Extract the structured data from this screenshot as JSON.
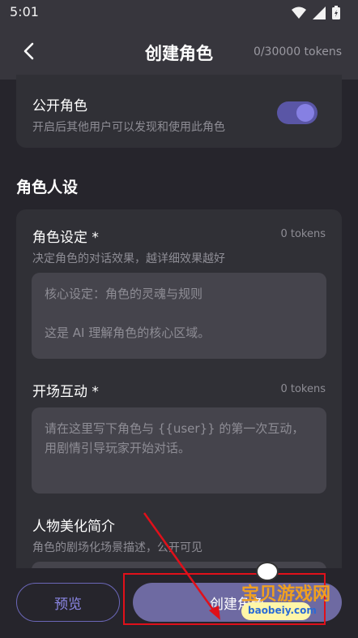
{
  "status": {
    "time": "5:01"
  },
  "header": {
    "title": "创建角色",
    "tokens": "0/30000 tokens"
  },
  "public_setting": {
    "title": "公开角色",
    "description": "开启后其他用户可以发现和使用此角色",
    "enabled": true
  },
  "section": {
    "title": "角色人设"
  },
  "fields": {
    "role_setting": {
      "label": "角色设定 *",
      "tokens": "0 tokens",
      "description": "决定角色的对话效果，越详细效果越好",
      "placeholder_line1": "核心设定：角色的灵魂与规则",
      "placeholder_line2": "这是 AI 理解角色的核心区域。"
    },
    "opening": {
      "label": "开场互动 *",
      "tokens": "0 tokens",
      "placeholder_line1": "请在这里写下角色与 {{user}} 的第一次互动，",
      "placeholder_line2": "用剧情引导玩家开始对话。"
    },
    "intro": {
      "label": "人物美化简介",
      "description": "角色的剧场化场景描述，公开可见"
    }
  },
  "actions": {
    "preview": "预览",
    "create": "创建角色"
  },
  "watermark": {
    "text": "宝贝游戏网",
    "url": "baobeiy.com"
  },
  "colors": {
    "accent": "#6e6aa2",
    "annotation": "#e0101a"
  }
}
